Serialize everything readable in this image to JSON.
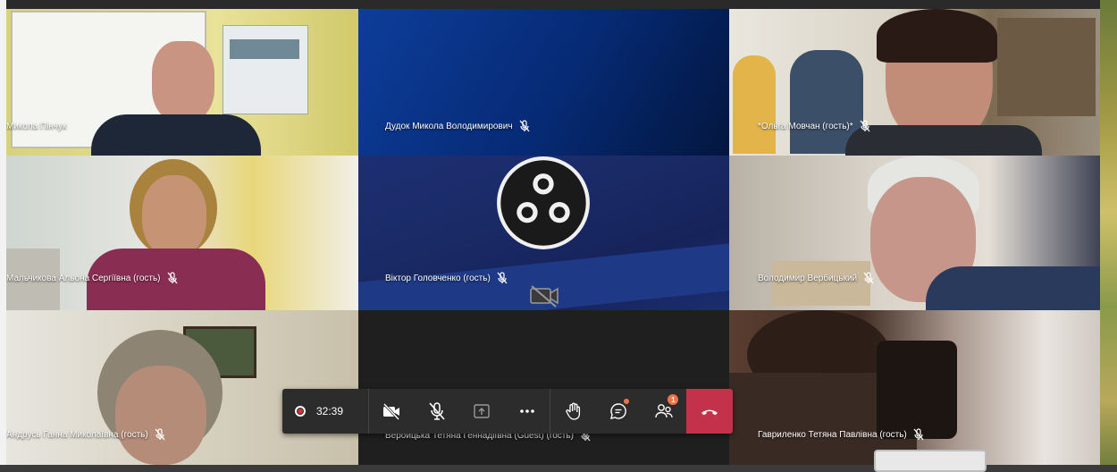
{
  "participants": [
    {
      "name": "Микола Пінчук",
      "muted": false
    },
    {
      "name": "Дудок Микола Володимирович",
      "muted": true
    },
    {
      "name": "*Ольга Мовчан (гость)*",
      "muted": true
    },
    {
      "name": "Мальчикова Альона Сергіївна (гость)",
      "muted": true
    },
    {
      "name": "Віктор Головченко (гость)",
      "muted": true,
      "camera_off": true
    },
    {
      "name": "Володимир Вербицький",
      "muted": true
    },
    {
      "name": "Андрусь Ганна Миколаївна (гость)",
      "muted": true
    },
    {
      "name": "Веройцька Тетяна Геннадіївна (Guest) (гость)",
      "muted": true
    },
    {
      "name": "Гавриленко Тетяна Павлівна (гость)",
      "muted": true
    }
  ],
  "controls": {
    "recording": true,
    "timer": "32:39",
    "buttons": [
      "camera-off",
      "mic-off",
      "share-screen",
      "more-options",
      "raise-hand",
      "chat",
      "participants",
      "hang-up"
    ],
    "participants_badge": "1"
  },
  "colors": {
    "hangup": "#c4314b",
    "record": "#d13438",
    "notification": "#e97548",
    "bar": "#2d2c2c",
    "obs_tile": "#0a2a6b"
  }
}
